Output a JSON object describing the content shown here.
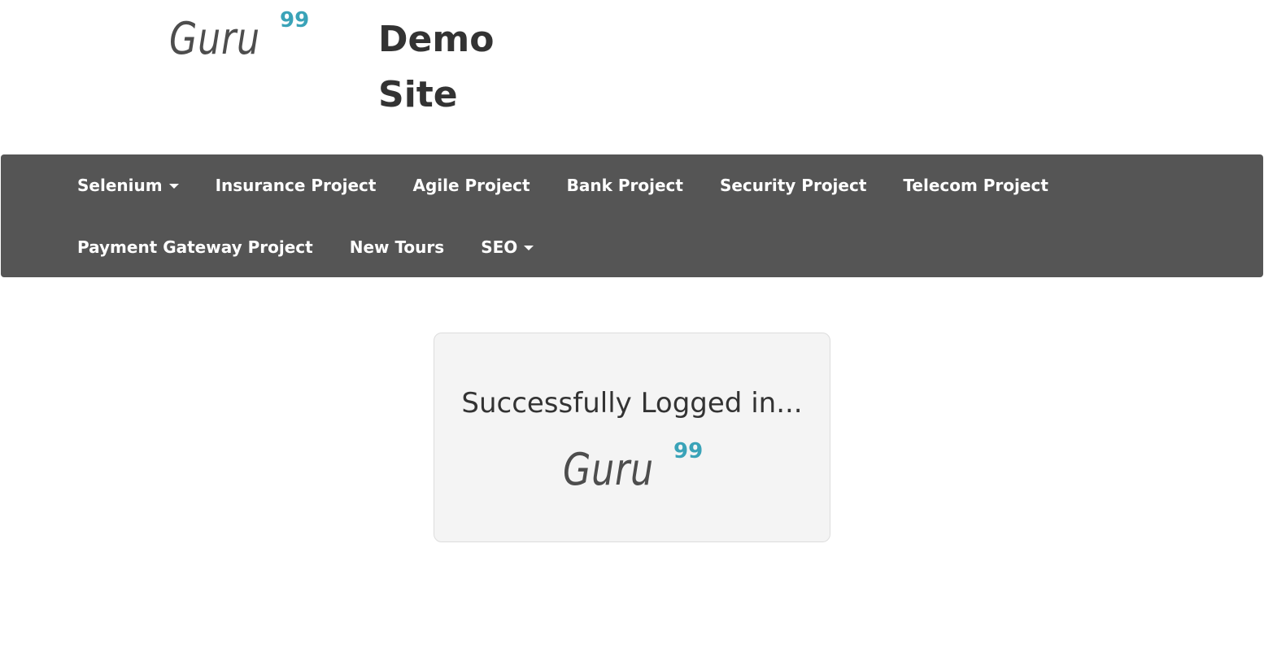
{
  "header": {
    "logo": {
      "text": "Guru",
      "superscript": "99"
    },
    "site_title": "Demo Site"
  },
  "nav": {
    "items": [
      {
        "label": "Selenium",
        "dropdown": true
      },
      {
        "label": "Insurance Project",
        "dropdown": false
      },
      {
        "label": "Agile Project",
        "dropdown": false
      },
      {
        "label": "Bank Project",
        "dropdown": false
      },
      {
        "label": "Security Project",
        "dropdown": false
      },
      {
        "label": "Telecom Project",
        "dropdown": false
      },
      {
        "label": "Payment Gateway Project",
        "dropdown": false
      },
      {
        "label": "New Tours",
        "dropdown": false
      },
      {
        "label": "SEO",
        "dropdown": true
      }
    ]
  },
  "panel": {
    "message": "Successfully Logged in...",
    "logo": {
      "text": "Guru",
      "superscript": "99"
    }
  },
  "colors": {
    "navbar_bg": "#555555",
    "logo_accent": "#3aa3b8",
    "panel_bg": "#f4f4f4"
  }
}
